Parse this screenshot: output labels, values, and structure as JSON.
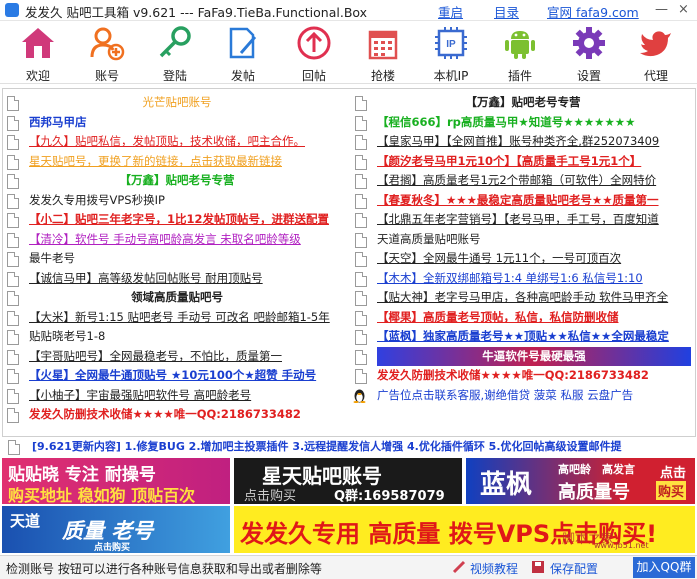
{
  "window": {
    "title": "发发久  贴吧工具箱 v9.621 --- FaFa9.TieBa.Functional.Box",
    "links": [
      "重启",
      "目录",
      "官网 fafa9.com"
    ],
    "minimize": "—",
    "close": "×"
  },
  "toolbar": [
    {
      "label": "欢迎",
      "icon": "home-icon"
    },
    {
      "label": "账号",
      "icon": "add-user-icon"
    },
    {
      "label": "登陆",
      "icon": "key-icon"
    },
    {
      "label": "发帖",
      "icon": "edit-icon"
    },
    {
      "label": "回帖",
      "icon": "reply-icon"
    },
    {
      "label": "抢楼",
      "icon": "calendar-icon"
    },
    {
      "label": "本机IP",
      "icon": "ip-icon"
    },
    {
      "label": "插件",
      "icon": "android-icon"
    },
    {
      "label": "设置",
      "icon": "gear-icon"
    },
    {
      "label": "代理",
      "icon": "bird-icon"
    }
  ],
  "left_rows": [
    {
      "text": "光芒贴吧账号",
      "color": "#f0a020",
      "align": "center"
    },
    {
      "text": "西邦马甲店",
      "color": "#1a3fd0",
      "bold": true
    },
    {
      "text": "【九久】贴吧私信，发帖顶贴，技术收储，吧主合作。",
      "color": "#e02020",
      "underline": true
    },
    {
      "text": "星天贴吧号，更换了新的链接，点击获取最新链接",
      "color": "#f0a020",
      "underline": true
    },
    {
      "text": "【万鑫】贴吧老号专营",
      "color": "#18b020",
      "bold": true,
      "align": "center"
    },
    {
      "text": "发发久专用拨号VPS秒换IP",
      "color": "#222222"
    },
    {
      "text": "【小二】贴吧三年老字号，1比12发帖顶帖号，进群送配置",
      "color": "#e02020",
      "bold": true,
      "underline": true
    },
    {
      "text": "【清冷】软件号 手动号高吧龄高发言 未取名吧龄等级",
      "color": "#b020c0",
      "underline": true
    },
    {
      "text": "最牛老号",
      "color": "#222222"
    },
    {
      "text": "【诚信马甲】高等级发帖回帖账号 耐用顶贴号",
      "color": "#222222",
      "underline": true
    },
    {
      "text": "领域高质量贴吧号",
      "color": "#222222",
      "bold": true,
      "align": "center"
    },
    {
      "text": "【大米】新号1:15 贴吧老号 手动号 可改名 吧龄邮箱1-5年",
      "color": "#222222",
      "underline": true
    },
    {
      "text": "贴贴晓老号1-8",
      "color": "#222222"
    },
    {
      "text": "【宇哥贴吧号】全网最稳老号，不怕比，质量第一",
      "color": "#222222",
      "underline": true
    },
    {
      "text": "【火星】全网最牛通顶贴号 ★10元100个★超赞 手动号",
      "color": "#1a3fd0",
      "bold": true,
      "underline": true
    },
    {
      "text": "【小柚子】宇宙最强贴吧软件号 高吧龄老号",
      "color": "#222222",
      "underline": true
    },
    {
      "text": "发发久防删技术收储★★★★唯一QQ:2186733482",
      "color": "#e02020",
      "bold": true
    }
  ],
  "right_rows": [
    {
      "text": "【万鑫】贴吧老号专营",
      "color": "#222222",
      "bold": true,
      "align": "center"
    },
    {
      "text": "【程信666】rp高质量马甲★知道号★★★★★★★",
      "color": "#18b020",
      "bold": true
    },
    {
      "text": "【皇家马甲】【全网首推】账号种类齐全,群252073409",
      "color": "#222222",
      "underline": true
    },
    {
      "text": "【颜汐老号马甲1元10个】【高质量手工号1元1个】",
      "color": "#e02020",
      "bold": true,
      "underline": true
    },
    {
      "text": "【君搁】高质量老号1元2个带邮箱（可软件）全网特价",
      "color": "#222222",
      "underline": true
    },
    {
      "text": "【春夏秋冬】★★★最稳定高质量贴吧老号★★质量第一",
      "color": "#e02020",
      "bold": true,
      "underline": true
    },
    {
      "text": "【北鼎五年老字营销号】【老号马甲，手工号，百度知道",
      "color": "#222222",
      "underline": true
    },
    {
      "text": "天道高质量贴吧账号",
      "color": "#222222"
    },
    {
      "text": "【天空】全网最牛通号 1元11个，一号可顶百次",
      "color": "#222222",
      "underline": true
    },
    {
      "text": "【木木】全新双绑邮箱号1:4 单绑号1:6 私信号1:10",
      "color": "#1a3fd0",
      "underline": true
    },
    {
      "text": "【贴大神】老字号马甲店，各种高吧龄手动 软件马甲齐全",
      "color": "#222222",
      "underline": true
    },
    {
      "text": "【椰果】高质量老号顶帖，私信，私信防删收储",
      "color": "#e02020",
      "bold": true,
      "underline": true
    },
    {
      "text": "【蓝枫】独家高质量老号★★顶贴★★私信★★全网最稳定",
      "color": "#1a3fd0",
      "bold": true,
      "underline": true
    },
    {
      "text": "牛逼软件号最硬最强",
      "color": "#ffffff",
      "bold": true,
      "align": "center",
      "bg": "linear-gradient(90deg,#3040e0,#c02050,#2040e0)"
    },
    {
      "text": "发发久防删技术收储★★★★唯一QQ:2186733482",
      "color": "#e02020",
      "bold": true
    },
    {
      "text": "广告位点击联系客服,谢绝借贷 菠菜 私服 云盘广告",
      "color": "#1a3fd0",
      "penguin": true
    }
  ],
  "news": "[9.621更新内容] 1.修复BUG   2.增加吧主投票插件   3.远程提醒发信人增强   4.优化插件循环   5.优化回帖高级设置邮件提",
  "banners": {
    "b1_line1": "贴贴晓 专注 耐操号",
    "b1_line2": "购买地址 稳如狗 顶贴百次",
    "b2_line1": "星天贴吧账号",
    "b2_line2a": "点击购买",
    "b2_line2b": "Q群:169587079",
    "b3_big": "蓝枫",
    "b3_a": "高吧龄",
    "b3_b": "高发言",
    "b3_c": "高质量号",
    "b3_d": "点击",
    "b3_e": "购买",
    "b4_line1": "天道",
    "b4_line2": "质量 老号",
    "b4_line3": "点击购买",
    "b5_text": "发发久专用 高质量 拨号VPS点击购买!",
    "b5_watermark": "脚本之家",
    "b5_url": "www.jb51.net"
  },
  "status": {
    "text": "检测账号  按钮可以进行各种账号信息获取和导出或者删除等",
    "video": "视频教程",
    "save": "保存配置",
    "qq": "加入QQ群"
  }
}
